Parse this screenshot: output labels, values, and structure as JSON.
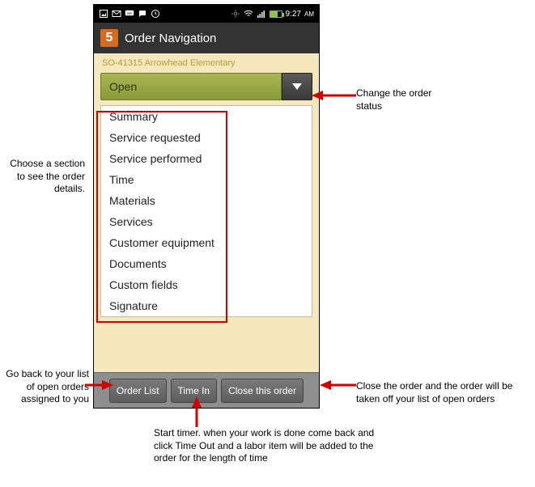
{
  "status_bar": {
    "time": "9:27",
    "ampm": "AM"
  },
  "header": {
    "logo": "5",
    "title": "Order Navigation"
  },
  "order_ref": "SO-41315 Arrowhead Elementary",
  "status": {
    "selected": "Open"
  },
  "sections": [
    "Summary",
    "Service requested",
    "Service performed",
    "Time",
    "Materials",
    "Services",
    "Customer equipment",
    "Documents",
    "Custom fields",
    "Signature"
  ],
  "bottom": {
    "order_list": "Order List",
    "time_in": "Time In",
    "close_order": "Close this order"
  },
  "annotations": {
    "change_status": "Change the order status",
    "choose_section": "Choose a section to see the order details.",
    "go_back": "Go back to your list of open orders assigned to you",
    "close_order": "Close the order and the order will be taken off your list of open orders",
    "start_timer": "Start timer. when your work is done come back and click Time Out and a labor item will be added to the order for the length of time"
  }
}
